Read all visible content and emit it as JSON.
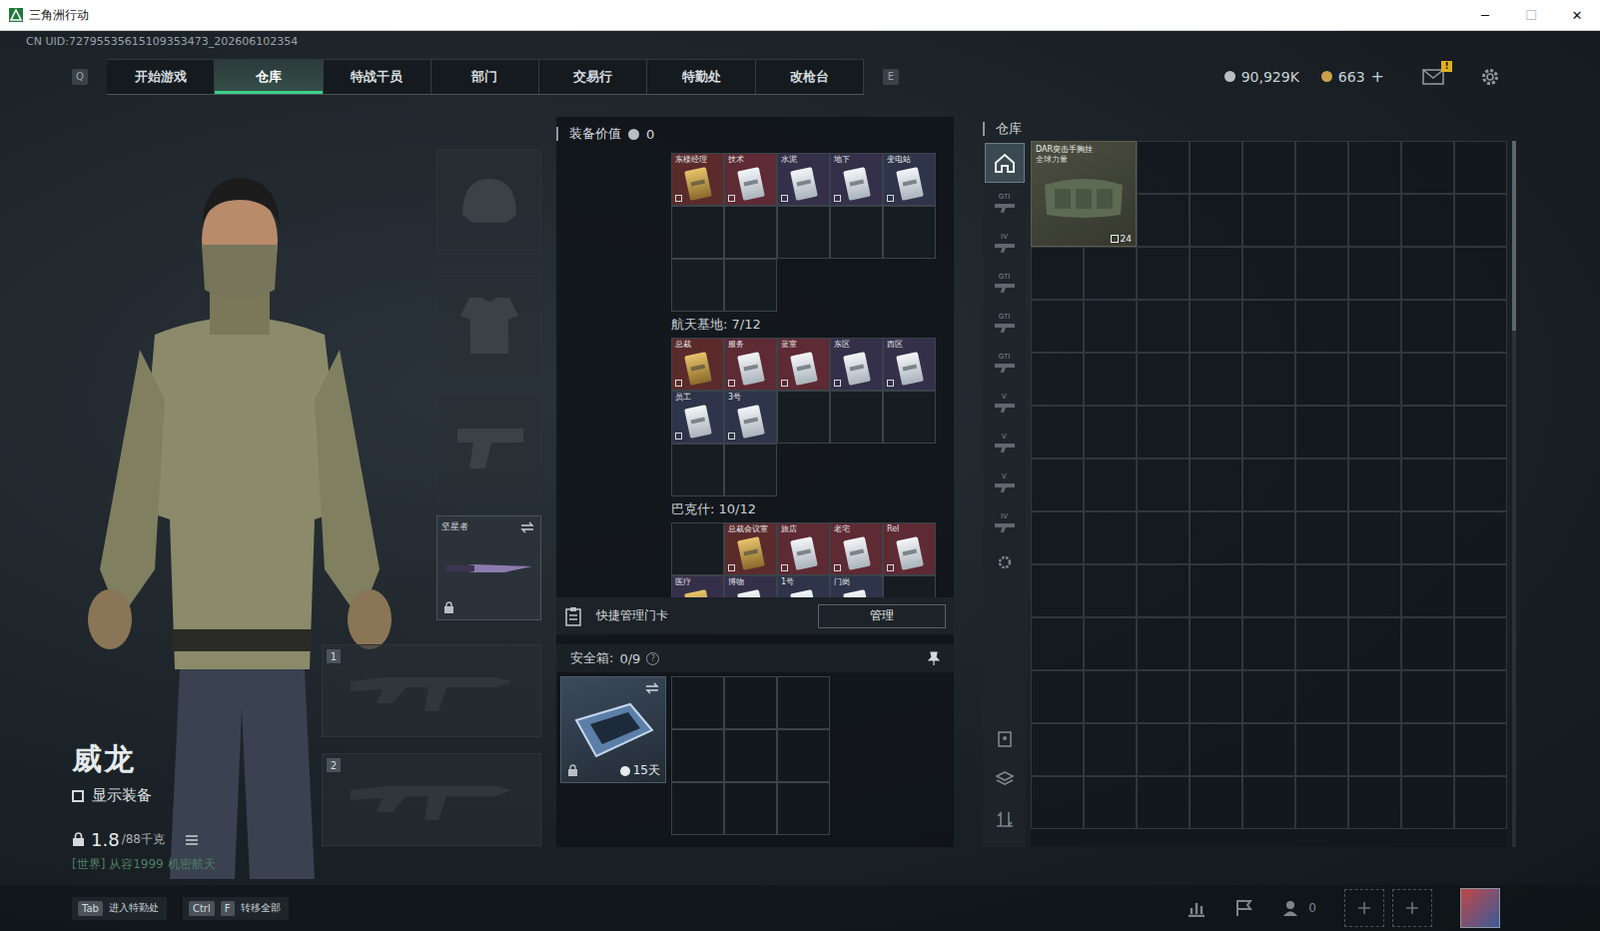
{
  "window": {
    "title": "三角洲行动",
    "controls": [
      {
        "glyph": "─",
        "disabled": false
      },
      {
        "glyph": "☐",
        "disabled": true
      },
      {
        "glyph": "✕",
        "disabled": false
      }
    ]
  },
  "uid": "CN UID:72795535615109353473_202606102354",
  "nav": {
    "prevKey": "Q",
    "nextKey": "E",
    "tabs": [
      {
        "label": "开始游戏",
        "selected": false
      },
      {
        "label": "仓库",
        "selected": true
      },
      {
        "label": "特战干员",
        "selected": false
      },
      {
        "label": "部门",
        "selected": false
      },
      {
        "label": "交易行",
        "selected": false
      },
      {
        "label": "特勤处",
        "selected": false
      },
      {
        "label": "改枪台",
        "selected": false
      }
    ]
  },
  "currencies": [
    {
      "amount": "90,929K",
      "color": "#b8bec4",
      "add": ""
    },
    {
      "amount": "663",
      "color": "#c9a24a",
      "add": "+"
    }
  ],
  "mail": {
    "badge": "!"
  },
  "operator": {
    "name": "威龙",
    "showGear": {
      "label": "显示装备",
      "checked": false
    },
    "weight": "1.8",
    "capacity": "/88千克",
    "chat": "[世界] 从容1999  机密航天"
  },
  "gearSlots": [
    {
      "kind": "helmet",
      "label": "",
      "filled": false,
      "locked": false
    },
    {
      "kind": "armor",
      "label": "",
      "filled": false,
      "locked": false
    },
    {
      "kind": "pistol",
      "label": "",
      "filled": false,
      "locked": false
    },
    {
      "kind": "melee",
      "label": "坚星者",
      "filled": true,
      "locked": true
    }
  ],
  "weaponSlots": [
    {
      "index": "1",
      "filled": false
    },
    {
      "index": "2",
      "filled": false
    }
  ],
  "loadout": {
    "title": "装备价值",
    "value": "0"
  },
  "keycards": [
    {
      "title": "",
      "slots": [
        {
          "label": "东楼经理",
          "kind": "gold",
          "color": "#5b2b2c"
        },
        {
          "label": "技术",
          "kind": "silver",
          "color": "#5e2a33"
        },
        {
          "label": "水泥",
          "kind": "silver",
          "color": "#35304a"
        },
        {
          "label": "地下",
          "kind": "silver",
          "color": "#35304a"
        },
        {
          "label": "变电站",
          "kind": "silver",
          "color": "#2e3449"
        },
        {
          "label": "",
          "kind": "empty",
          "color": "#171c21"
        },
        {
          "label": "",
          "kind": "empty",
          "color": "#171c21"
        },
        {
          "label": "",
          "kind": "empty",
          "color": "#171c21"
        },
        {
          "label": "",
          "kind": "empty",
          "color": "#171c21"
        },
        {
          "label": "",
          "kind": "empty",
          "color": "#171c21"
        },
        {
          "label": "",
          "kind": "empty",
          "color": "#171c21"
        },
        {
          "label": "",
          "kind": "empty",
          "color": "#171c21"
        }
      ]
    },
    {
      "title": "航天基地: 7/12",
      "slots": [
        {
          "label": "总裁",
          "kind": "gold",
          "color": "#5b2b2c"
        },
        {
          "label": "服务",
          "kind": "silver",
          "color": "#5e2a33"
        },
        {
          "label": "蓝室",
          "kind": "silver",
          "color": "#5e2a33"
        },
        {
          "label": "东区",
          "kind": "silver",
          "color": "#35304a"
        },
        {
          "label": "西区",
          "kind": "silver",
          "color": "#35304a"
        },
        {
          "label": "员工",
          "kind": "silver",
          "color": "#2e3449"
        },
        {
          "label": "3号",
          "kind": "silver",
          "color": "#2e3449"
        },
        {
          "label": "",
          "kind": "empty",
          "color": "#171c21"
        },
        {
          "label": "",
          "kind": "empty",
          "color": "#171c21"
        },
        {
          "label": "",
          "kind": "empty",
          "color": "#171c21"
        },
        {
          "label": "",
          "kind": "empty",
          "color": "#171c21"
        },
        {
          "label": "",
          "kind": "empty",
          "color": "#171c21"
        }
      ]
    },
    {
      "title": "巴克什: 10/12",
      "slots": [
        {
          "label": "",
          "kind": "empty",
          "color": "#171c21"
        },
        {
          "label": "总裁会议室",
          "kind": "gold",
          "color": "#5b2b2c"
        },
        {
          "label": "旅店",
          "kind": "silver",
          "color": "#5e2a33"
        },
        {
          "label": "老宅",
          "kind": "silver",
          "color": "#5e2a33"
        },
        {
          "label": "Rel",
          "kind": "silver",
          "color": "#5e2a33"
        },
        {
          "label": "医疗",
          "kind": "gold",
          "color": "#35304a"
        },
        {
          "label": "博物",
          "kind": "silver",
          "color": "#35304a"
        },
        {
          "label": "1号",
          "kind": "silver",
          "color": "#2e3449"
        },
        {
          "label": "门岗",
          "kind": "silver",
          "color": "#2e3449"
        },
        {
          "label": "",
          "kind": "empty",
          "color": "#171c21"
        }
      ]
    }
  ],
  "quickManage": {
    "label": "快捷管理门卡",
    "button": "管理"
  },
  "safebox": {
    "title": "安全箱:",
    "count": "0/9",
    "help": "?",
    "timer": "15天",
    "locked": true,
    "slots": 9
  },
  "stash": {
    "title": "仓库",
    "rows": 13,
    "cols": 9,
    "items": [
      {
        "name": "DAR突击手胸挂",
        "brand": "全球力量",
        "count": "24"
      }
    ],
    "categories": [
      {
        "kind": "home",
        "tag": "",
        "selected": true
      },
      {
        "kind": "weapon",
        "tag": "GTI",
        "selected": false
      },
      {
        "kind": "weapon",
        "tag": "IV",
        "selected": false
      },
      {
        "kind": "weapon",
        "tag": "GTI",
        "selected": false
      },
      {
        "kind": "weapon",
        "tag": "GTI",
        "selected": false
      },
      {
        "kind": "weapon",
        "tag": "GTI",
        "selected": false
      },
      {
        "kind": "weapon",
        "tag": "V",
        "selected": false
      },
      {
        "kind": "weapon",
        "tag": "V",
        "selected": false
      },
      {
        "kind": "weapon",
        "tag": "V",
        "selected": false
      },
      {
        "kind": "weapon",
        "tag": "IV",
        "selected": false
      },
      {
        "kind": "settings",
        "tag": "",
        "selected": false
      }
    ],
    "tools": [
      "locker",
      "layers",
      "sort"
    ]
  },
  "bottomBar": {
    "hints": [
      {
        "keys": [
          "Tab"
        ],
        "label": "进入特勤处"
      },
      {
        "keys": [
          "Ctrl",
          "F"
        ],
        "label": "转移全部"
      }
    ],
    "friends": "0",
    "addSlots": 2
  }
}
